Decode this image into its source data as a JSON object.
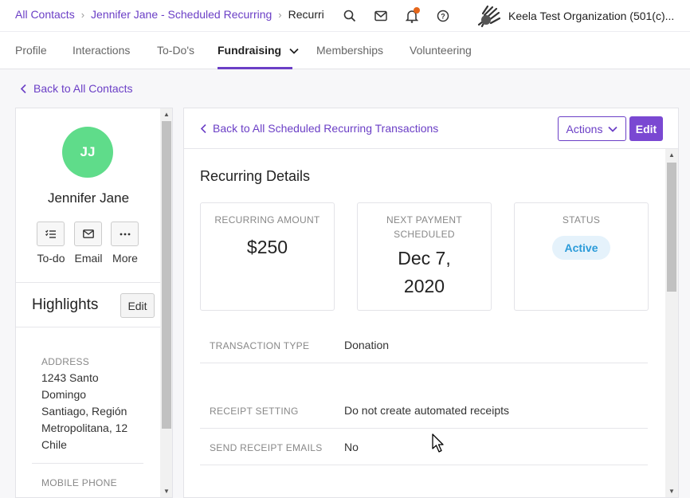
{
  "breadcrumb": {
    "items": [
      "All Contacts",
      "Jennifer Jane - Scheduled Recurring"
    ],
    "current": "Recurring Transaction"
  },
  "header": {
    "icons": [
      "search-icon",
      "mail-icon",
      "bell-icon",
      "help-icon"
    ],
    "org_name": "Keela Test Organization (501(c)..."
  },
  "tabs": [
    {
      "label": "Profile"
    },
    {
      "label": "Interactions"
    },
    {
      "label": "To-Do's"
    },
    {
      "label": "Fundraising",
      "active": true
    },
    {
      "label": "Memberships"
    },
    {
      "label": "Volunteering"
    }
  ],
  "back_link": "Back to All Contacts",
  "contact": {
    "initials": "JJ",
    "name": "Jennifer Jane",
    "avatar_color": "#5fdc8a",
    "actions": [
      {
        "label": "To-do",
        "icon": "todo-list-icon"
      },
      {
        "label": "Email",
        "icon": "email-icon"
      },
      {
        "label": "More",
        "icon": "more-icon"
      }
    ]
  },
  "highlights": {
    "title": "Highlights",
    "edit_label": "Edit",
    "address_label": "ADDRESS",
    "address_lines": [
      "1243 Santo",
      "Domingo",
      "Santiago, Región",
      "Metropolitana, 12",
      "Chile"
    ],
    "phone_label": "MOBILE PHONE"
  },
  "main": {
    "back_label": "Back to All Scheduled Recurring Transactions",
    "actions_label": "Actions",
    "edit_label": "Edit",
    "title": "Recurring Details",
    "cards": {
      "amount_label": "RECURRING AMOUNT",
      "amount_value": "$250",
      "next_label_1": "NEXT PAYMENT",
      "next_label_2": "SCHEDULED",
      "next_value_1": "Dec 7,",
      "next_value_2": "2020",
      "status_label": "STATUS",
      "status_value": "Active"
    },
    "rows": [
      {
        "label": "TRANSACTION TYPE",
        "value": "Donation"
      },
      {
        "label": "RECEIPT SETTING",
        "value": "Do not create automated receipts"
      },
      {
        "label": "SEND RECEIPT EMAILS",
        "value": "No"
      }
    ]
  },
  "colors": {
    "accent": "#6b3fc6",
    "button_primary": "#7a48d2",
    "status_text": "#2b9bd9",
    "status_bg": "#e5f2fb",
    "notification": "#e5661b"
  }
}
